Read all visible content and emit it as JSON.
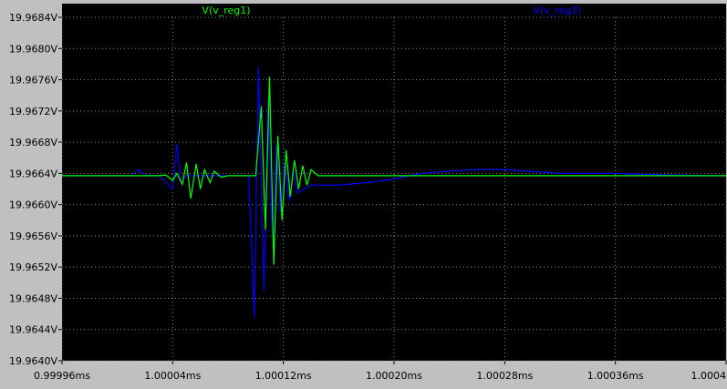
{
  "chart_data": {
    "type": "line",
    "title": "",
    "xlabel": "",
    "ylabel": "",
    "grid": true,
    "legend": "top",
    "xlim": [
      0.99996,
      1.00044
    ],
    "ylim": [
      19.964,
      19.9684
    ],
    "x_ticks": [
      {
        "value": 0.99996,
        "label": "0.99996ms"
      },
      {
        "value": 1.00004,
        "label": "1.00004ms"
      },
      {
        "value": 1.00012,
        "label": "1.00012ms"
      },
      {
        "value": 1.0002,
        "label": "1.00020ms"
      },
      {
        "value": 1.00028,
        "label": "1.00028ms"
      },
      {
        "value": 1.00036,
        "label": "1.00036ms"
      },
      {
        "value": 1.00044,
        "label": "1.0004"
      }
    ],
    "y_ticks": [
      {
        "value": 19.9684,
        "label": "19.9684V"
      },
      {
        "value": 19.968,
        "label": "19.9680V"
      },
      {
        "value": 19.9676,
        "label": "19.9676V"
      },
      {
        "value": 19.9672,
        "label": "19.9672V"
      },
      {
        "value": 19.9668,
        "label": "19.9668V"
      },
      {
        "value": 19.9664,
        "label": "19.9664V"
      },
      {
        "value": 19.966,
        "label": "19.9660V"
      },
      {
        "value": 19.9656,
        "label": "19.9656V"
      },
      {
        "value": 19.9652,
        "label": "19.9652V"
      },
      {
        "value": 19.9648,
        "label": "19.9648V"
      },
      {
        "value": 19.9644,
        "label": "19.9644V"
      },
      {
        "value": 19.964,
        "label": "19.9640V"
      }
    ],
    "series": [
      {
        "name": "V(v_reg1)",
        "color": "#00ff00",
        "x": [
          0.99996,
          1.0,
          1.00003,
          1.000035,
          1.00004,
          1.000043,
          1.000047,
          1.00005,
          1.000053,
          1.000057,
          1.00006,
          1.000063,
          1.000067,
          1.00007,
          1.000075,
          1.00008,
          1.00009,
          1.0001,
          1.000104,
          1.000107,
          1.00011,
          1.000113,
          1.000116,
          1.000119,
          1.000122,
          1.000125,
          1.000128,
          1.000131,
          1.000134,
          1.000137,
          1.00014,
          1.000145,
          1.00016,
          1.0002,
          1.0003,
          1.0004,
          1.00044
        ],
        "y": [
          19.96637,
          19.96637,
          19.96637,
          19.96638,
          19.96631,
          19.9664,
          19.96626,
          19.96654,
          19.96608,
          19.96652,
          19.9662,
          19.96645,
          19.96628,
          19.96643,
          19.96635,
          19.96637,
          19.96637,
          19.96637,
          19.96726,
          19.96568,
          19.96764,
          19.96523,
          19.96688,
          19.9658,
          19.9667,
          19.9661,
          19.96657,
          19.9662,
          19.9665,
          19.96625,
          19.96645,
          19.96637,
          19.96637,
          19.96637,
          19.96637,
          19.96637,
          19.96637
        ]
      },
      {
        "name": "V(v_reg3)",
        "color": "#0000ff",
        "x": [
          0.99996,
          1.00001,
          1.000015,
          1.00002,
          1.00003,
          1.00004,
          1.000043,
          1.000046,
          1.00005,
          1.00006,
          1.00008,
          1.000095,
          1.000099,
          1.000102,
          1.000106,
          1.000109,
          1.000112,
          1.000115,
          1.000118,
          1.000121,
          1.000124,
          1.000127,
          1.00013,
          1.00014,
          1.00016,
          1.00018,
          1.0002,
          1.00022,
          1.00024,
          1.00026,
          1.00028,
          1.00032,
          1.00036,
          1.0004,
          1.00044
        ],
        "y": [
          19.96637,
          19.96637,
          19.96645,
          19.96638,
          19.96637,
          19.9662,
          19.96678,
          19.96628,
          19.96637,
          19.96637,
          19.96637,
          19.96637,
          19.96455,
          19.96776,
          19.9649,
          19.96737,
          19.9656,
          19.96677,
          19.9659,
          19.96655,
          19.96605,
          19.96645,
          19.96615,
          19.96625,
          19.96625,
          19.96628,
          19.96633,
          19.9664,
          19.96643,
          19.96645,
          19.96645,
          19.9664,
          19.9664,
          19.96638,
          19.96637
        ]
      }
    ]
  }
}
